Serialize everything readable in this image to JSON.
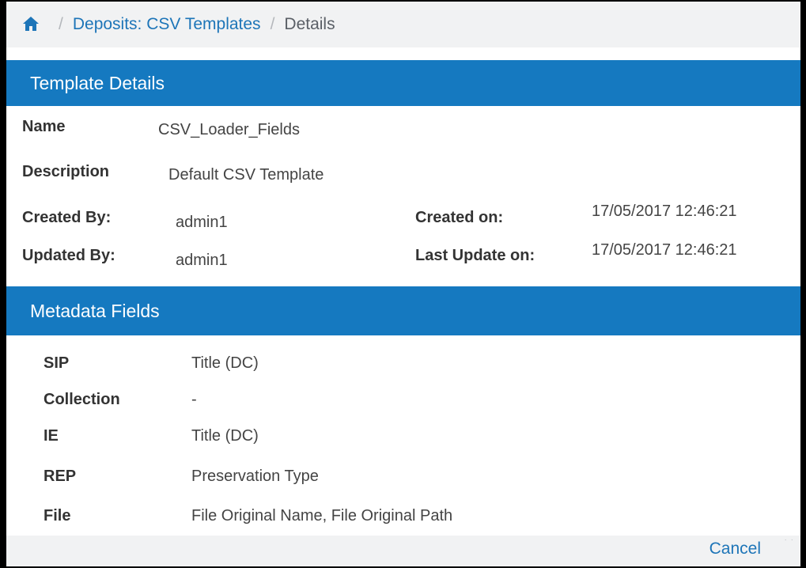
{
  "breadcrumb": {
    "home_icon": "home-icon",
    "separator": "/",
    "link": "Deposits: CSV Templates",
    "current": "Details"
  },
  "template_details": {
    "header": "Template Details",
    "name_label": "Name",
    "name_value": "CSV_Loader_Fields",
    "description_label": "Description",
    "description_value": "Default CSV Template",
    "created_by_label": "Created By:",
    "created_by_value": "admin1",
    "updated_by_label": "Updated By:",
    "updated_by_value": "admin1",
    "created_on_label": "Created on:",
    "created_on_value": "17/05/2017 12:46:21",
    "last_update_label": "Last Update on:",
    "last_update_value": "17/05/2017 12:46:21"
  },
  "metadata_fields": {
    "header": "Metadata Fields",
    "rows": [
      {
        "label": "SIP",
        "value": "Title (DC)"
      },
      {
        "label": "Collection",
        "value": "-"
      },
      {
        "label": "IE",
        "value": "Title (DC)"
      },
      {
        "label": "REP",
        "value": "Preservation Type"
      },
      {
        "label": "File",
        "value": "File Original Name, File Original Path"
      }
    ]
  },
  "footer": {
    "cancel_label": "Cancel"
  },
  "colors": {
    "header_bg": "#1579c0",
    "link": "#1d75b8",
    "breadcrumb_bg": "#f1f2f3"
  }
}
